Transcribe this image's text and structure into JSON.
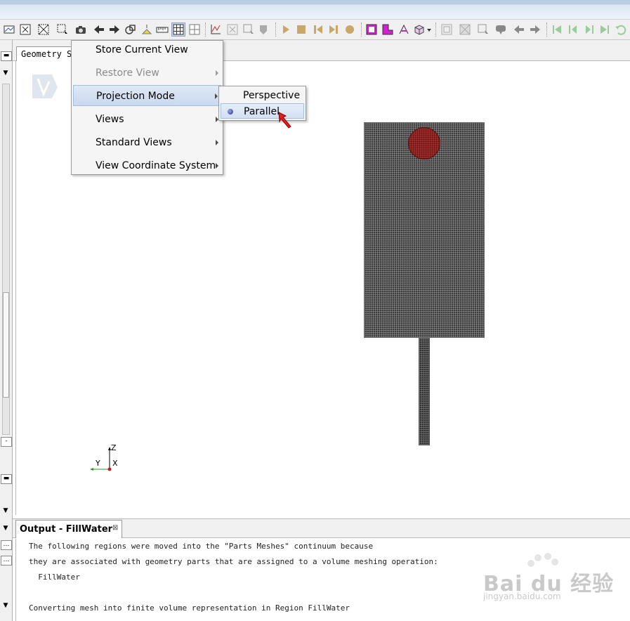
{
  "scene_tab": {
    "label": "Geometry S"
  },
  "context_menu": {
    "items": [
      {
        "label": "Store Current View",
        "enabled": true,
        "has_submenu": false
      },
      {
        "label": "Restore View",
        "enabled": false,
        "has_submenu": true
      },
      {
        "label": "Projection Mode",
        "enabled": true,
        "has_submenu": true,
        "highlighted": true
      },
      {
        "label": "Views",
        "enabled": true,
        "has_submenu": true
      },
      {
        "label": "Standard Views",
        "enabled": true,
        "has_submenu": true
      },
      {
        "label": "View Coordinate System",
        "enabled": true,
        "has_submenu": true
      }
    ]
  },
  "projection_submenu": {
    "items": [
      {
        "label": "Perspective",
        "selected": false
      },
      {
        "label": "Parallel",
        "selected": true
      }
    ]
  },
  "triad": {
    "z": "Z",
    "y": "Y",
    "x": "X"
  },
  "output": {
    "tab_label": "Output - FillWater",
    "close_glyph": "⊠",
    "lines": [
      "The following regions were moved into the \"Parts Meshes\" continuum because",
      "they are associated with geometry parts that are assigned to a volume meshing operation:",
      "  FillWater",
      "",
      "Converting mesh into finite volume representation in Region FillWater"
    ]
  },
  "watermark": {
    "brand": "Bai du 经验",
    "url": "jingyan.baidu.com"
  },
  "colors": {
    "mesh": "#3c3c3c",
    "circle": "#a42a2a",
    "menu_highlight": "#cad9ee",
    "cursor_arrow": "#e02020"
  }
}
